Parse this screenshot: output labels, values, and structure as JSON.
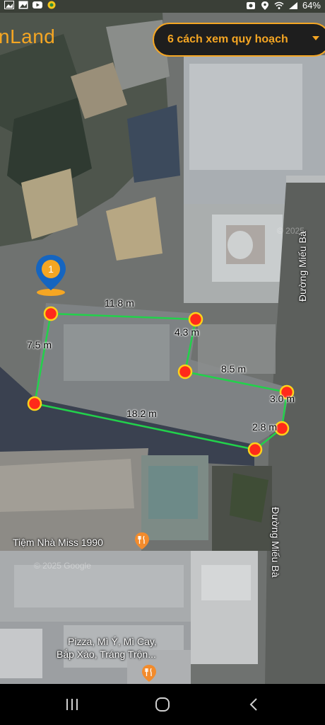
{
  "status_bar": {
    "battery_text": "64%",
    "icons": [
      "image-icon",
      "photo-icon",
      "youtube-icon",
      "app-icon",
      "vpn-icon",
      "location-icon",
      "wifi-icon",
      "signal-icon",
      "battery-icon"
    ]
  },
  "app": {
    "brand_partial": "nLand",
    "plan_button_label": "6 cách xem quy hoạch",
    "accent_color": "#f5a623"
  },
  "map": {
    "parcel_pin_label": "1",
    "edge_lengths": [
      "11.8 m",
      "4.3 m",
      "8.5 m",
      "3.0 m",
      "2.8 m",
      "18.2 m",
      "7.5 m"
    ],
    "streets": [
      "Đường Miếu Bà",
      "Đường Miếu Bà"
    ],
    "pois": [
      {
        "name": "Tiệm Nhà Miss 1990",
        "icon": "restaurant-icon"
      },
      {
        "name_line1": "Pizza, Mì Ý, Mì Cay,",
        "name_line2": "Bắp Xào, Tráng Trộn...",
        "icon": "restaurant-icon"
      }
    ],
    "watermarks": [
      "© 2025 Google",
      "© 2025"
    ]
  },
  "navbar": {
    "buttons": [
      "recent-apps-icon",
      "home-icon",
      "back-icon"
    ]
  }
}
